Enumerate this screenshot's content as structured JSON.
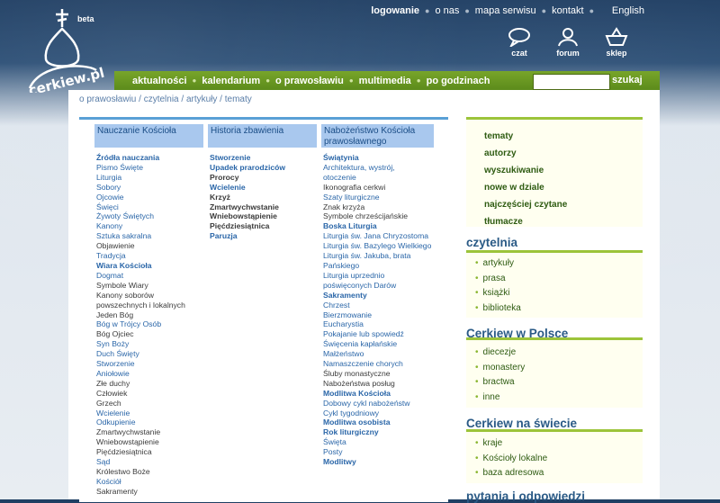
{
  "header": {
    "beta": "beta",
    "logo_text": "cerkiew.pl",
    "topnav": [
      "logowanie",
      "o nas",
      "mapa serwisu",
      "kontakt"
    ],
    "english": "English",
    "icons": [
      {
        "label": "czat",
        "icon": "chat-bubble-icon"
      },
      {
        "label": "forum",
        "icon": "forum-people-icon"
      },
      {
        "label": "sklep",
        "icon": "shop-basket-icon"
      }
    ]
  },
  "mainnav": [
    "aktualności",
    "kalendarium",
    "o prawosławiu",
    "multimedia",
    "po godzinach"
  ],
  "search": {
    "button": "szukaj",
    "value": ""
  },
  "breadcrumb": "o prawosławiu  / czytelnia  / artykuły  / tematy",
  "columns": [
    {
      "title": "Nauczanie Kościoła",
      "items": [
        {
          "t": "Źródła nauczania",
          "s": "hdr"
        },
        {
          "t": "Pismo Święte",
          "s": "lnk"
        },
        {
          "t": "Liturgia",
          "s": "lnk"
        },
        {
          "t": "Sobory",
          "s": "lnk"
        },
        {
          "t": "Ojcowie",
          "s": "lnk"
        },
        {
          "t": "Święci",
          "s": "lnk"
        },
        {
          "t": "Żywoty Świętych",
          "s": "lnk"
        },
        {
          "t": "Kanony",
          "s": "lnk"
        },
        {
          "t": "Sztuka sakralna",
          "s": "lnk"
        },
        {
          "t": "Objawienie",
          "s": "blk"
        },
        {
          "t": "Tradycja",
          "s": "lnk"
        },
        {
          "t": "Wiara Kościoła",
          "s": "hdr"
        },
        {
          "t": "Dogmat",
          "s": "lnk"
        },
        {
          "t": "Symbole Wiary",
          "s": "blk"
        },
        {
          "t": "Kanony soborów",
          "s": "blk"
        },
        {
          "t": "powszechnych i lokalnych",
          "s": "blk"
        },
        {
          "t": "Jeden Bóg",
          "s": "blk"
        },
        {
          "t": "Bóg w Trójcy Osób",
          "s": "lnk"
        },
        {
          "t": "Bóg Ojciec",
          "s": "blk"
        },
        {
          "t": "Syn Boży",
          "s": "lnk"
        },
        {
          "t": "Duch Święty",
          "s": "lnk"
        },
        {
          "t": "Stworzenie",
          "s": "lnk"
        },
        {
          "t": "Aniołowie",
          "s": "lnk"
        },
        {
          "t": "Złe duchy",
          "s": "blk"
        },
        {
          "t": "Człowiek",
          "s": "blk"
        },
        {
          "t": "Grzech",
          "s": "blk"
        },
        {
          "t": "Wcielenie",
          "s": "lnk"
        },
        {
          "t": "Odkupienie",
          "s": "lnk"
        },
        {
          "t": "Zmartwychwstanie",
          "s": "blk"
        },
        {
          "t": "Wniebowstąpienie",
          "s": "blk"
        },
        {
          "t": "Pięćdziesiątnica",
          "s": "blk"
        },
        {
          "t": "Sąd",
          "s": "lnk"
        },
        {
          "t": "Królestwo Boże",
          "s": "blk"
        },
        {
          "t": "Kościół",
          "s": "lnk"
        },
        {
          "t": "Sakramenty",
          "s": "blk"
        }
      ]
    },
    {
      "title": "Historia zbawienia",
      "items": [
        {
          "t": "Stworzenie",
          "s": "hdr"
        },
        {
          "t": "Upadek prarodziców",
          "s": "hdr"
        },
        {
          "t": "Prorocy",
          "s": "hdrb"
        },
        {
          "t": "Wcielenie",
          "s": "hdr"
        },
        {
          "t": "Krzyż",
          "s": "hdrb"
        },
        {
          "t": "Zmartwychwstanie",
          "s": "hdrb"
        },
        {
          "t": "Wniebowstąpienie",
          "s": "hdrb"
        },
        {
          "t": "Pięćdziesiątnica",
          "s": "hdrb"
        },
        {
          "t": "Paruzja",
          "s": "hdr"
        }
      ]
    },
    {
      "title": "Nabożeństwo Kościoła prawosławnego",
      "items": [
        {
          "t": "Świątynia",
          "s": "hdr"
        },
        {
          "t": "Architektura, wystrój,",
          "s": "lnk"
        },
        {
          "t": "otoczenie",
          "s": "lnk"
        },
        {
          "t": "Ikonografia cerkwi",
          "s": "blk"
        },
        {
          "t": "Szaty liturgiczne",
          "s": "lnk"
        },
        {
          "t": "Znak krzyża",
          "s": "blk"
        },
        {
          "t": "Symbole chrześcijańskie",
          "s": "blk"
        },
        {
          "t": "Boska Liturgia",
          "s": "hdr"
        },
        {
          "t": "Liturgia św. Jana Chryzostoma",
          "s": "lnk"
        },
        {
          "t": "Liturgia św. Bazylego Wielkiego",
          "s": "lnk"
        },
        {
          "t": "Liturgia św. Jakuba, brata",
          "s": "lnk"
        },
        {
          "t": "Pańskiego",
          "s": "lnk"
        },
        {
          "t": "Liturgia uprzednio",
          "s": "lnk"
        },
        {
          "t": "poświęconych Darów",
          "s": "lnk"
        },
        {
          "t": "Sakramenty",
          "s": "hdr"
        },
        {
          "t": "Chrzest",
          "s": "lnk"
        },
        {
          "t": "Bierzmowanie",
          "s": "lnk"
        },
        {
          "t": "Eucharystia",
          "s": "lnk"
        },
        {
          "t": "Pokajanie lub spowiedź",
          "s": "lnk"
        },
        {
          "t": "Święcenia kapłańskie",
          "s": "lnk"
        },
        {
          "t": "Małżeństwo",
          "s": "lnk"
        },
        {
          "t": "Namaszczenie chorych",
          "s": "lnk"
        },
        {
          "t": "Śluby monastyczne",
          "s": "blk"
        },
        {
          "t": "Nabożeństwa posług",
          "s": "blk"
        },
        {
          "t": "Modlitwa Kościoła",
          "s": "hdr"
        },
        {
          "t": "Dobowy cykl nabożeństw",
          "s": "lnk"
        },
        {
          "t": "Cykl tygodniowy",
          "s": "lnk"
        },
        {
          "t": "Modlitwa osobista",
          "s": "hdr"
        },
        {
          "t": "Rok liturgiczny",
          "s": "hdr"
        },
        {
          "t": "Święta",
          "s": "lnk"
        },
        {
          "t": "Posty",
          "s": "lnk"
        },
        {
          "t": "Modlitwy",
          "s": "hdr"
        }
      ]
    }
  ],
  "sidebar": {
    "menu": [
      "tematy",
      "autorzy",
      "wyszukiwanie",
      "nowe w dziale",
      "najczęściej czytane",
      "tłumacze"
    ],
    "sections": [
      {
        "title": "czytelnia",
        "items": [
          "artykuły",
          "prasa",
          "książki",
          "biblioteka"
        ]
      },
      {
        "title": "Cerkiew w Polsce",
        "items": [
          "diecezje",
          "monastery",
          "bractwa",
          "inne"
        ]
      },
      {
        "title": "Cerkiew na świecie",
        "items": [
          "kraje",
          "Kościoły lokalne",
          "baza adresowa"
        ]
      },
      {
        "title": "pytania i odpowiedzi",
        "items": []
      }
    ]
  },
  "colors": {
    "nav_green": "#6b9a22",
    "head_blue": "#a9c8ee",
    "link_blue": "#2a66a8",
    "side_green": "#9cc43a"
  }
}
